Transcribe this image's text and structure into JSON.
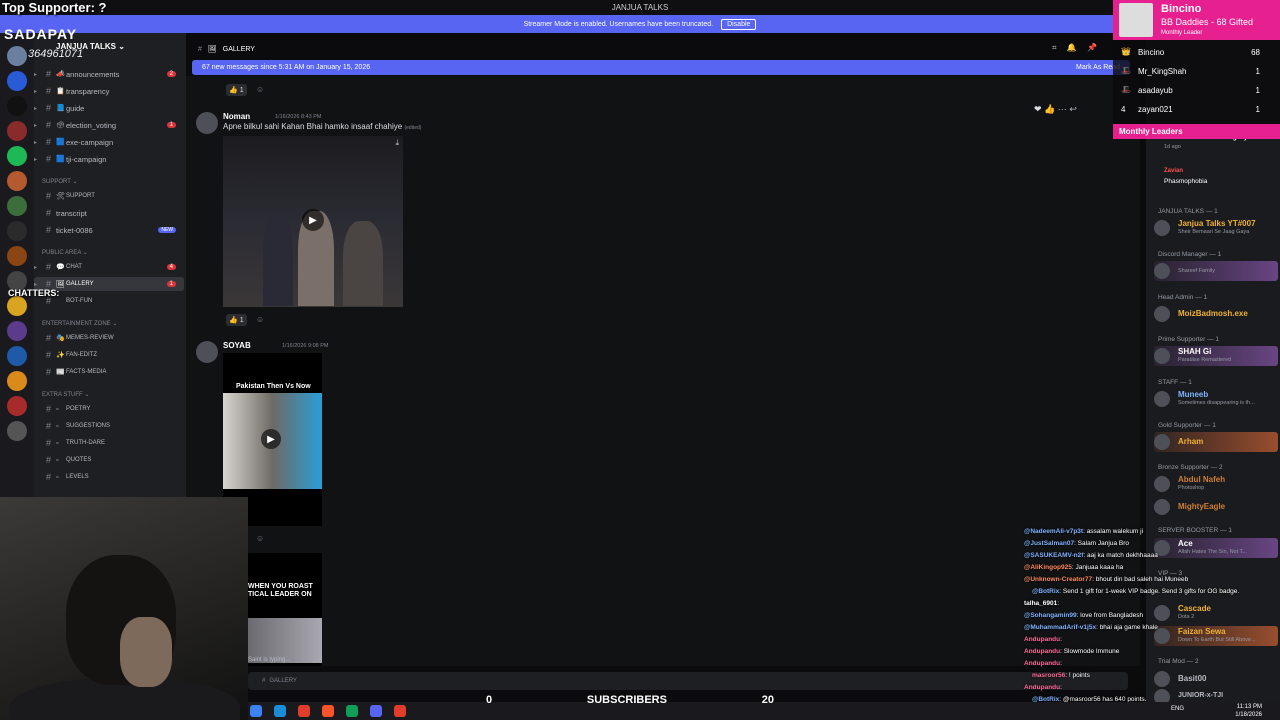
{
  "overlay": {
    "top_supporter": "Top Supporter: ?",
    "sadapay": "SADAPAY",
    "sadapay_number": "364961071",
    "chatters": "CHATTERS:"
  },
  "window": {
    "title": "JANJUA TALKS"
  },
  "banner": {
    "text": "Streamer Mode is enabled. Usernames have been truncated.",
    "button": "Disable"
  },
  "server": {
    "name": "JANJUA TALKS",
    "channels": [
      {
        "label": "announcements",
        "badge": "2"
      },
      {
        "label": "transparency",
        "badge": ""
      },
      {
        "label": "guide",
        "badge": ""
      },
      {
        "label": "election_voting",
        "badge": "1"
      },
      {
        "label": "exe-campaign",
        "badge": ""
      },
      {
        "label": "tji-campaign",
        "badge": ""
      }
    ],
    "support_category": "SUPPORT",
    "support_sub": "SUPPORT",
    "transcript": "transcript",
    "ticket": "ticket-0086",
    "new_badge": "NEW",
    "public_category": "PUBLIC AREA",
    "chat_channel": "CHAT",
    "chat_badge": "4",
    "gallery_channel": "GALLERY",
    "gallery_badge": "1",
    "bot_fun": "BOT-FUN",
    "entertainment_category": "ENTERTAINMENT ZONE",
    "memes": "MEMES-REVIEW",
    "fan_edits": "FAN-EDITZ",
    "facts": "FACTS-MEDIA",
    "extra_category": "EXTRA STUFF",
    "poetry": "POETRY",
    "suggestions": "SUGGESTIONS",
    "truth": "TRUTH-DARE",
    "quotes": "QUOTES",
    "levels": "LEVELS"
  },
  "chat": {
    "channel": "GALLERY",
    "new_messages": "67 new messages since 5:31 AM on January 15, 2026",
    "mark_as_read": "Mark As Read",
    "reaction_count": "1",
    "messages": [
      {
        "author": "Noman",
        "time": "1/16/2026 8:43 PM",
        "text": "Apne bilkul sahi Kahan Bhai hamko insaaf chahiye",
        "edited": "(edited)",
        "reactions": "1"
      },
      {
        "author": "SOYAB",
        "time": "1/16/2026 9:08 PM",
        "thumb_title": "Pakistan Then Vs Now",
        "thumb2_title": "WHEN YOU ROAST TICAL LEADER ON"
      }
    ],
    "typing": "Saint is typing...",
    "composer": "GALLERY"
  },
  "leaderboard": {
    "name": "Bincino",
    "sub": "BB Daddies - 68 Gifted",
    "tag": "Monthly Leader",
    "rows": [
      {
        "name": "Bincino",
        "value": "68"
      },
      {
        "name": "Mr_KingShah",
        "value": "1"
      },
      {
        "name": "asadayub",
        "value": "1"
      },
      {
        "name": "zayan021",
        "value": "1"
      }
    ],
    "footer": "Monthly Leaders"
  },
  "members": {
    "activity1": "Grand Theft Auto V Legacy",
    "activity1_time": "1d ago",
    "zavian": "Zavian",
    "activity2": "Phasmophobia",
    "janjua_group": "JANJUA TALKS — 1",
    "janjua_name": "Janjua Talks YT#007",
    "janjua_status": "Sheir Bemaari Se Jaag Gaya",
    "discord_group": "Discord Manager — 1",
    "discord_status": "Shareef Family",
    "head_group": "Head Admin — 1",
    "head_name": "MoizBadmosh.exe",
    "prime_group": "Prime Supporter — 1",
    "prime_name": "SHAH Gi",
    "prime_status": "Paradise Remastered",
    "staff_group": "STAFF — 1",
    "staff_name": "Muneeb",
    "staff_status": "Sometimes disappearing is th...",
    "gold_group": "Gold Supporter — 1",
    "gold_name": "Arham",
    "bronze_group": "Bronze Supporter — 2",
    "bronze1": "Abdul Nafeh",
    "bronze1_status": "Photoshop",
    "bronze2": "MightyEagle",
    "booster_group": "SERVER BOOSTER — 1",
    "booster_name": "Ace",
    "booster_status": "Allah Hates The Sin, Not T...",
    "vip_group": "VIP — 3",
    "vip1": "Cascade",
    "vip1_status": "Dota 2",
    "vip2": "Faizan Sewa",
    "vip2_status": "Down To Earth But Still Above...",
    "trial_group": "Trial Mod — 2",
    "trial1": "Basit00",
    "trial2": "JUNIOR-x-TJI"
  },
  "stream_chat": [
    {
      "user": "@NadeemAli-v7p3t",
      "text": ": assalam walekum ji",
      "color": "#7fb3ff"
    },
    {
      "user": "@JustSalman07",
      "text": ": Salam Janjua Bro",
      "color": "#7fb3ff"
    },
    {
      "user": "@SASUKEAMV-n2f",
      "text": ": aaj ka match dekhhaaaa",
      "color": "#7fb3ff"
    },
    {
      "user": "@AliKingop925",
      "text": ": Janjuaa kaaa ha",
      "color": "#ff8a5c"
    },
    {
      "user": "@Unknown-Creator77",
      "text": ": bhout din bad saleh hai Muneeb",
      "color": "#ff8a5c"
    },
    {
      "user": "@BotRix",
      "text": ": Send 1 gift for 1-week VIP badge. Send 3 gifts for OG badge.",
      "color": "#7fb3ff"
    },
    {
      "user": "talha_6901",
      "text": ":",
      "color": "#ffffff"
    },
    {
      "user": "@Sohangamin99",
      "text": ": love from Bangladesh",
      "color": "#7fb3ff"
    },
    {
      "user": "@MuhammadArif-v1j5x",
      "text": ": bhai aja game khale",
      "color": "#7fb3ff"
    },
    {
      "user": "Andupandu",
      "text": ":",
      "color": "#ff6b9a"
    },
    {
      "user": "Andupandu",
      "text": ": Slowmode Immune",
      "color": "#ff6b9a"
    },
    {
      "user": "Andupandu",
      "text": ":",
      "color": "#ff6b9a"
    },
    {
      "user": "masroor56",
      "text": ": ! points",
      "color": "#ff6b9a"
    },
    {
      "user": "Andupandu",
      "text": ":",
      "color": "#ff6b9a"
    },
    {
      "user": "@BotRix",
      "text": ": @masroor56 has 640 points.",
      "color": "#7fb3ff"
    }
  ],
  "subscribers": {
    "current": "0",
    "label": "SUBSCRIBERS",
    "goal": "20"
  },
  "taskbar": {
    "lang": "ENG",
    "time": "11:13 PM",
    "date": "1/18/2026"
  },
  "colors": {
    "banner": "#5865f2",
    "leaderboard": "#e6208e",
    "badge": "#da373c"
  }
}
